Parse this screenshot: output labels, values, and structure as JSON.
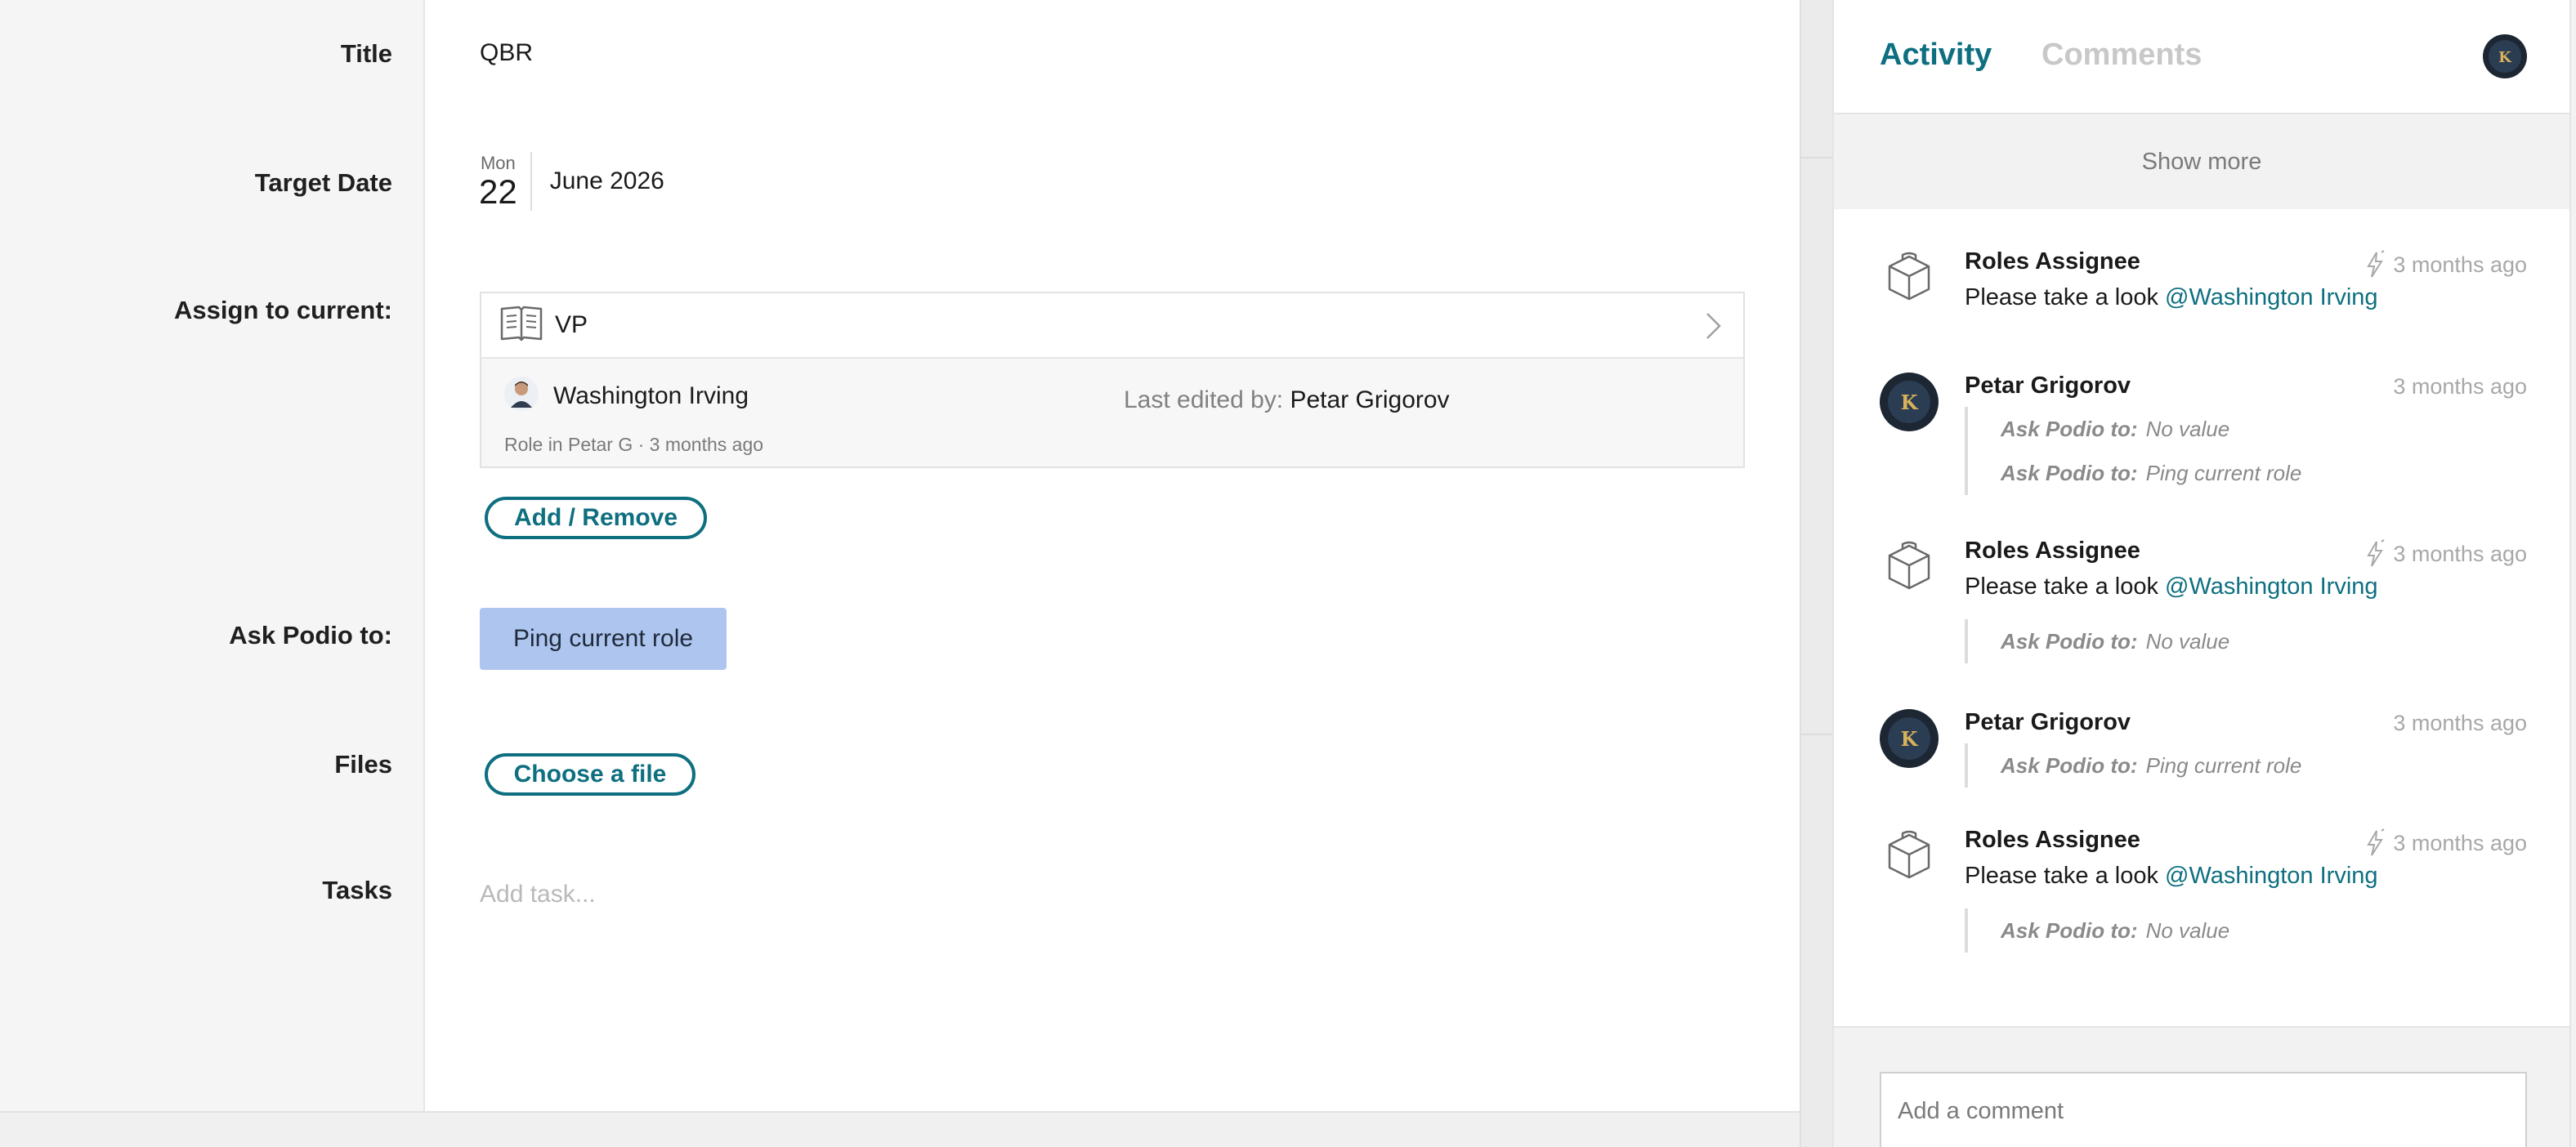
{
  "form": {
    "labels": {
      "title": "Title",
      "target_date": "Target Date",
      "assign": "Assign to current:",
      "ask_podio": "Ask Podio to:",
      "files": "Files",
      "tasks": "Tasks"
    },
    "title_value": "QBR",
    "target_date": {
      "weekday": "Mon",
      "day": "22",
      "month_year": "June 2026"
    },
    "reference": {
      "app_name": "VP",
      "person_name": "Washington Irving",
      "meta": "Role in Petar G · 3 months ago",
      "edited_label": "Last edited by:",
      "edited_by": "Petar Grigorov"
    },
    "add_remove_label": "Add / Remove",
    "ask_podio_value": "Ping current role",
    "choose_file_label": "Choose a file",
    "add_task_placeholder": "Add task..."
  },
  "sidebar": {
    "tabs": {
      "activity": "Activity",
      "comments": "Comments"
    },
    "show_more": "Show more",
    "feed": [
      {
        "author": "Roles Assignee",
        "time": "3 months ago",
        "text": "Please take a look",
        "mention": "@Washington Irving"
      },
      {
        "author": "Petar Grigorov",
        "time": "3 months ago",
        "changes": [
          {
            "label": "Ask Podio to:",
            "value": "No value"
          },
          {
            "label": "Ask Podio to:",
            "value": "Ping current role"
          }
        ]
      },
      {
        "author": "Roles Assignee",
        "time": "3 months ago",
        "text": "Please take a look",
        "mention": "@Washington Irving",
        "changes": [
          {
            "label": "Ask Podio to:",
            "value": "No value"
          }
        ]
      },
      {
        "author": "Petar Grigorov",
        "time": "3 months ago",
        "changes": [
          {
            "label": "Ask Podio to:",
            "value": "Ping current role"
          }
        ]
      },
      {
        "author": "Roles Assignee",
        "time": "3 months ago",
        "text": "Please take a look",
        "mention": "@Washington Irving",
        "changes": [
          {
            "label": "Ask Podio to:",
            "value": "No value"
          }
        ]
      }
    ],
    "comment_placeholder": "Add a comment"
  },
  "colors": {
    "accent": "#0e6f80",
    "primary_button": "#aec6ef",
    "muted": "#a8a8a8"
  }
}
